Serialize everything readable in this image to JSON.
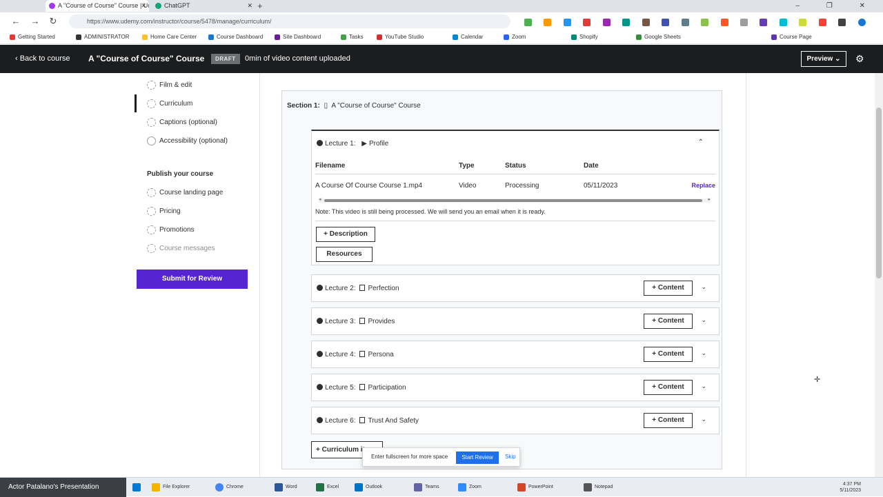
{
  "browser": {
    "tabs": [
      {
        "label": "A \"Course of Course\" Course | Udemy",
        "active": true,
        "color": "#a435f0"
      },
      {
        "label": "ChatGPT",
        "active": false,
        "color": "#10a37f"
      }
    ],
    "new_tab": "+",
    "window_controls": "–  ❐  ✕",
    "address": "https://www.udemy.com/instructor/course/5478/manage/curriculum/",
    "bookmarks": [
      "Getting Started",
      "ADMINISTRATOR",
      "Home Care Center",
      "Course Dashboard",
      "Site Dashboard",
      "Tasks",
      "YouTube Studio",
      "Calendar",
      "Zoom",
      "Shopify",
      "Google Sheets",
      "Course Page"
    ]
  },
  "header": {
    "back_label": "‹  Back to course",
    "course_title": "A \"Course of Course\" Course",
    "draft_badge": "DRAFT",
    "video_status": "0min of video content uploaded",
    "preview_label": "Preview  ⌄",
    "settings_icon": "gear-icon"
  },
  "sidebar": {
    "plan_items": [
      {
        "label": "Film & edit",
        "state": "todo"
      },
      {
        "label": "Curriculum",
        "state": "active"
      },
      {
        "label": "Captions (optional)",
        "state": "todo"
      },
      {
        "label": "Accessibility (optional)",
        "state": "done"
      }
    ],
    "publish_heading": "Publish your course",
    "publish_items": [
      {
        "label": "Course landing page",
        "state": "todo"
      },
      {
        "label": "Pricing",
        "state": "todo"
      },
      {
        "label": "Promotions",
        "state": "todo"
      },
      {
        "label": "Course messages",
        "state": "todo"
      }
    ],
    "submit_label": "Submit for Review"
  },
  "section": {
    "label": "Section 1:",
    "title": "A \"Course of Course\" Course"
  },
  "expanded_lecture": {
    "label": "Lecture 1:",
    "title": "Profile",
    "collapse_icon": "⌃",
    "columns": [
      "Filename",
      "Type",
      "Status",
      "Date"
    ],
    "file": {
      "filename": "A Course Of Course Course 1.mp4",
      "type": "Video",
      "status": "Processing",
      "date": "05/11/2023",
      "action": "Replace"
    },
    "note": "Note: This video is still being processed. We will send you an email when it is ready.",
    "description_btn": "+ Description",
    "resources_btn": "Resources"
  },
  "lectures": [
    {
      "label": "Lecture 2:",
      "title": "Perfection",
      "content_btn": "+ Content"
    },
    {
      "label": "Lecture 3:",
      "title": "Provides",
      "content_btn": "+ Content"
    },
    {
      "label": "Lecture 4:",
      "title": "Persona",
      "content_btn": "+ Content"
    },
    {
      "label": "Lecture 5:",
      "title": "Participation",
      "content_btn": "+ Content"
    },
    {
      "label": "Lecture 6:",
      "title": "Trust And Safety",
      "content_btn": "+ Content"
    }
  ],
  "curriculum_btn": "+ Curriculum item",
  "popup": {
    "text": "Enter fullscreen for more space",
    "primary": "Start Review",
    "secondary": "Skip"
  },
  "taskbar": {
    "active_window": "Actor Patalano's Presentation",
    "apps": [
      "File Explorer",
      "Chrome",
      "Word",
      "Excel",
      "Outlook",
      "Teams",
      "Zoom",
      "PowerPoint",
      "Notepad"
    ],
    "time": "4:37 PM",
    "date": "5/11/2023"
  }
}
